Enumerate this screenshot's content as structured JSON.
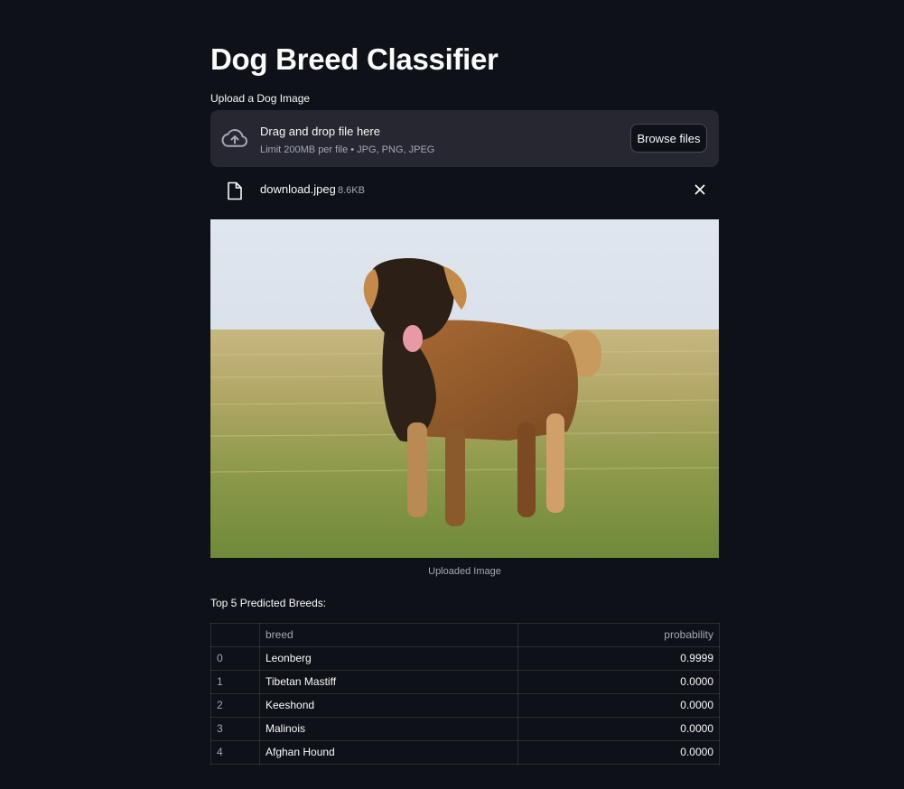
{
  "page": {
    "title": "Dog Breed Classifier",
    "upload_label": "Upload a Dog Image"
  },
  "uploader": {
    "drop_text": "Drag and drop file here",
    "limit_text": "Limit 200MB per file • JPG, PNG, JPEG",
    "browse_label": "Browse files",
    "icon": "cloud-upload-icon"
  },
  "file": {
    "name": "download.jpeg",
    "size": "8.6KB",
    "icon": "file-icon",
    "close_icon": "close-icon"
  },
  "image": {
    "caption": "Uploaded Image"
  },
  "predictions": {
    "label": "Top 5 Predicted Breeds:",
    "columns": [
      "",
      "breed",
      "probability"
    ],
    "rows": [
      {
        "index": "0",
        "breed": "Leonberg",
        "probability": "0.9999"
      },
      {
        "index": "1",
        "breed": "Tibetan Mastiff",
        "probability": "0.0000"
      },
      {
        "index": "2",
        "breed": "Keeshond",
        "probability": "0.0000"
      },
      {
        "index": "3",
        "breed": "Malinois",
        "probability": "0.0000"
      },
      {
        "index": "4",
        "breed": "Afghan Hound",
        "probability": "0.0000"
      }
    ]
  },
  "colors": {
    "background": "#0e1117",
    "panel": "#262730",
    "text": "#fafafa",
    "muted": "#a3a8b4"
  }
}
